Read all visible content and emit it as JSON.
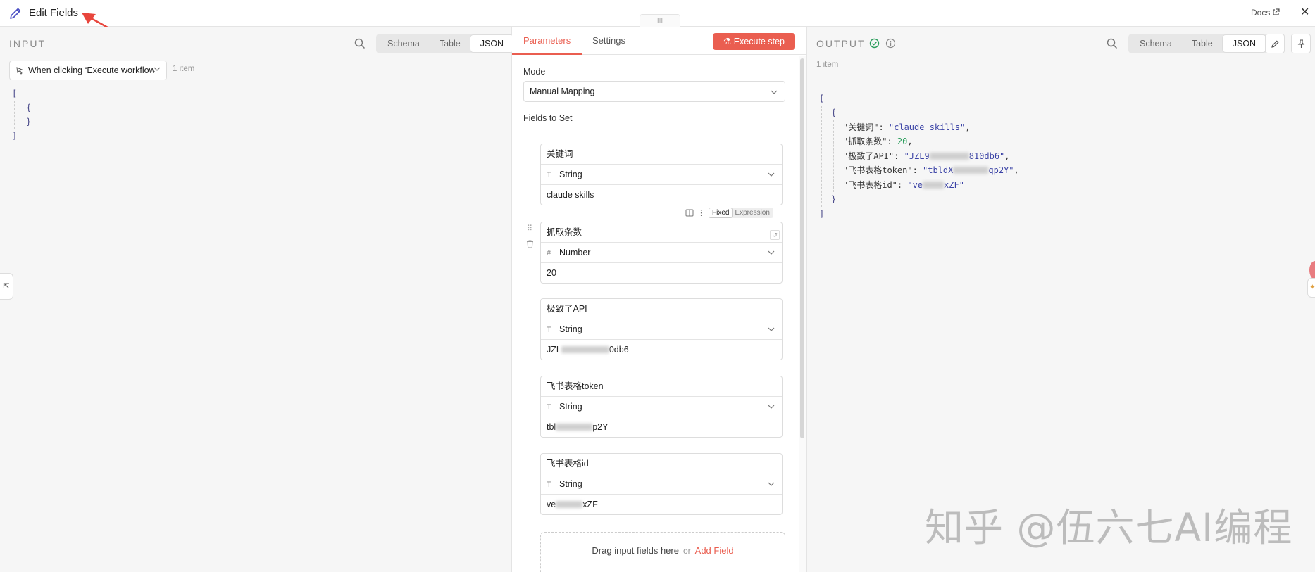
{
  "header": {
    "title": "Edit Fields",
    "drag_handle": "III",
    "docs_label": "Docs",
    "close_label": "✕"
  },
  "input_panel": {
    "label": "INPUT",
    "views": [
      "Schema",
      "Table",
      "JSON"
    ],
    "active_view": "JSON",
    "node_select": "When clicking ‘Execute workflow’",
    "item_count": "1 item",
    "json_lines": [
      "[",
      "{",
      "}",
      "]"
    ],
    "left_tab": "⇱"
  },
  "param_panel": {
    "tabs": [
      "Parameters",
      "Settings"
    ],
    "active_tab": "Parameters",
    "execute_label": "Execute step",
    "mode_label": "Mode",
    "mode_value": "Manual Mapping",
    "fields_label": "Fields to Set",
    "fields": [
      {
        "name": "关键词",
        "type": "String",
        "type_icon": "T",
        "value_prefix": "claude skills",
        "value_suffix": ""
      },
      {
        "name": "抓取条数",
        "type": "Number",
        "type_icon": "#",
        "value_prefix": "20",
        "value_suffix": ""
      },
      {
        "name": "极致了API",
        "type": "String",
        "type_icon": "T",
        "value_prefix": "JZL",
        "value_suffix": "0db6"
      },
      {
        "name": "飞书表格token",
        "type": "String",
        "type_icon": "T",
        "value_prefix": "tbl",
        "value_suffix": "p2Y"
      },
      {
        "name": "飞书表格id",
        "type": "String",
        "type_icon": "T",
        "value_prefix": "ve",
        "value_suffix": "xZF"
      }
    ],
    "mode_toggle": [
      "Fixed",
      "Expression"
    ],
    "active_mode_toggle": "Fixed",
    "drop_text": "Drag input fields here",
    "drop_or": "or",
    "add_field_label": "Add Field"
  },
  "output_panel": {
    "label": "OUTPUT",
    "views": [
      "Schema",
      "Table",
      "JSON"
    ],
    "active_view": "JSON",
    "item_count": "1 item",
    "json": {
      "open_bracket": "[",
      "open_brace": "{",
      "entries": [
        {
          "key": "\"关键词\": ",
          "value": "\"claude skills\"",
          "kind": "s",
          "blur_after": ""
        },
        {
          "key": "\"抓取条数\": ",
          "value": "20",
          "kind": "n",
          "blur_after": ""
        },
        {
          "key": "\"极致了API\": ",
          "value": "\"JZL9",
          "kind": "s",
          "blur_after": "810db6\""
        },
        {
          "key": "\"飞书表格token\": ",
          "value": "\"tbldX",
          "kind": "s",
          "blur_after": "qp2Y\""
        },
        {
          "key": "\"飞书表格id\": ",
          "value": "\"ve",
          "kind": "s",
          "blur_after": "xZF\""
        }
      ],
      "close_brace": "}",
      "close_bracket": "]"
    }
  },
  "watermark": "知乎 @伍六七AI编程",
  "colors": {
    "accent": "#ea5e50",
    "success": "#2a9d5b",
    "json_string": "#3b43a6"
  }
}
